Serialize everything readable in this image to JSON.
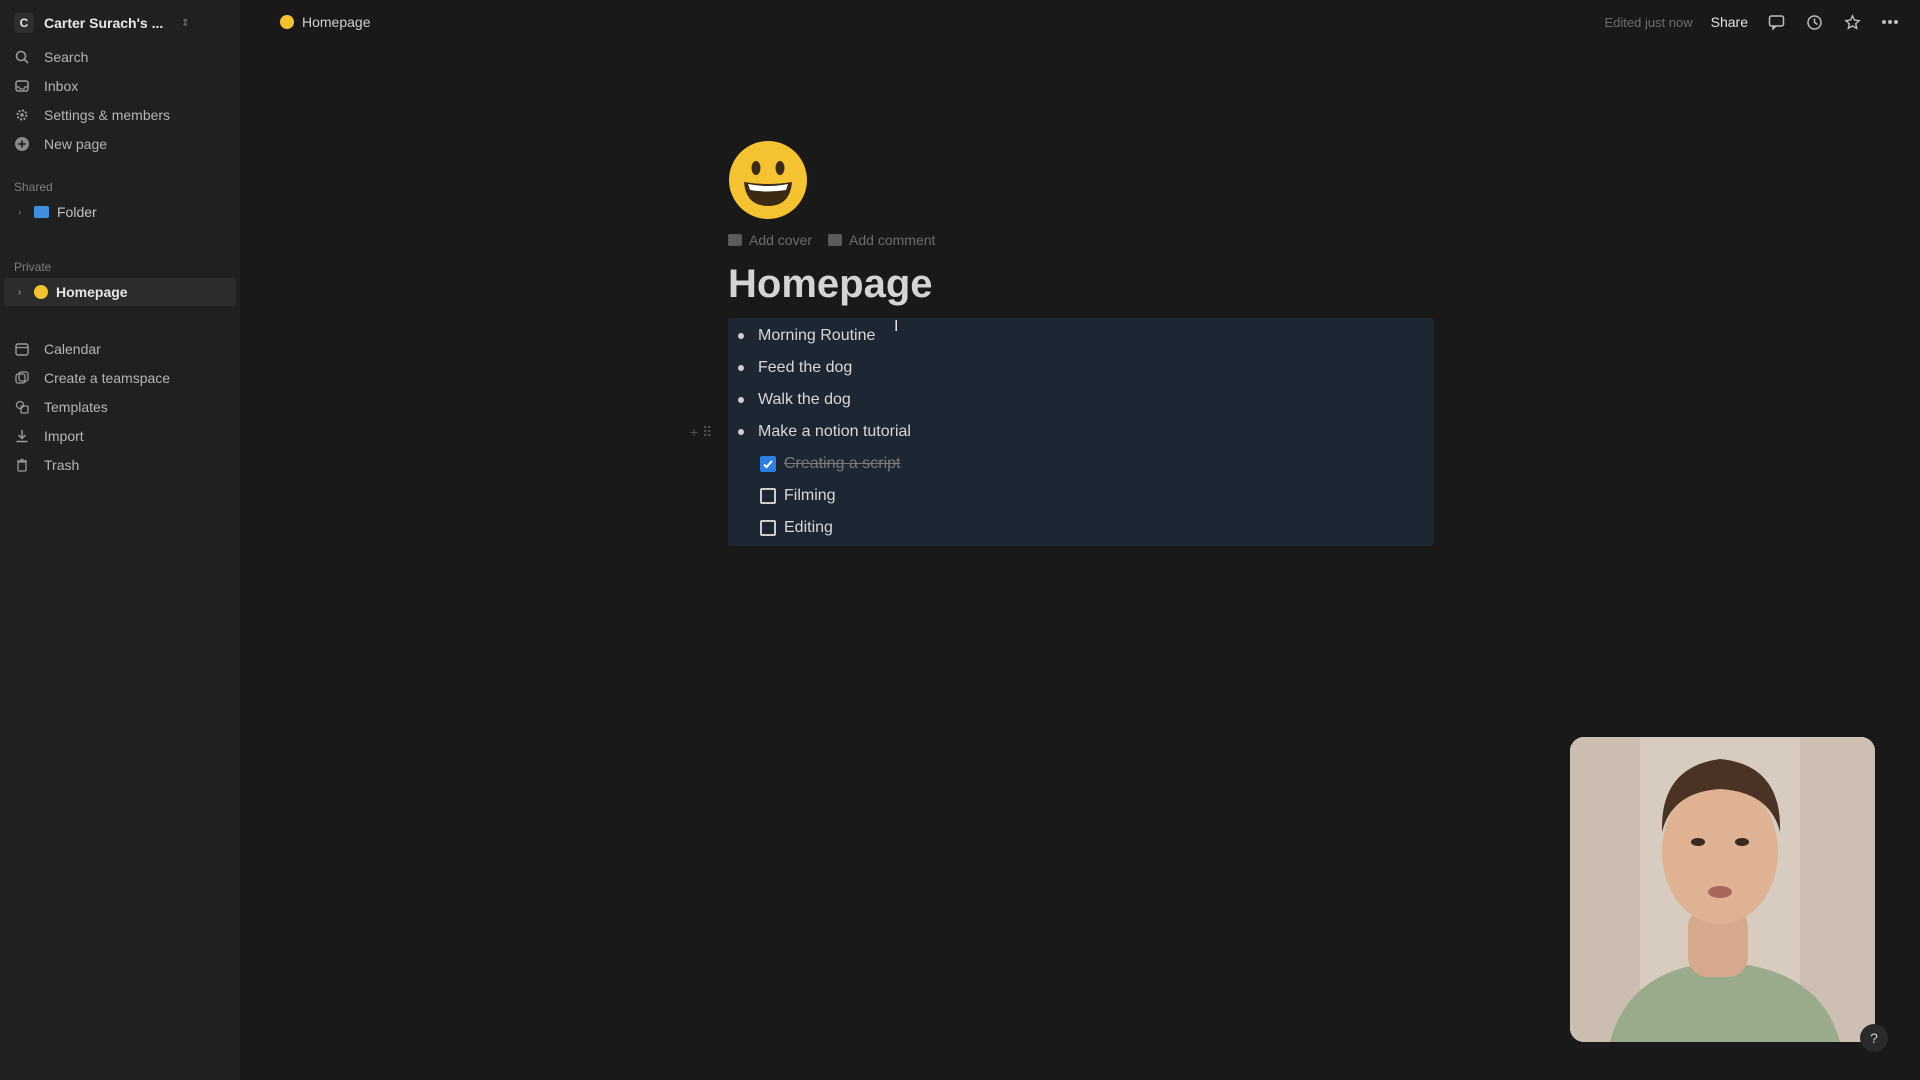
{
  "sidebar": {
    "workspace_initial": "C",
    "workspace_name": "Carter Surach's ...",
    "nav": [
      {
        "label": "Search",
        "icon": "search-icon"
      },
      {
        "label": "Inbox",
        "icon": "inbox-icon"
      },
      {
        "label": "Settings & members",
        "icon": "gear-icon"
      },
      {
        "label": "New page",
        "icon": "plus-circle-icon"
      }
    ],
    "shared_label": "Shared",
    "shared_items": [
      {
        "label": "Folder",
        "icon": "folder-icon"
      }
    ],
    "private_label": "Private",
    "private_items": [
      {
        "label": "Homepage",
        "icon": "smiley-emoji-icon"
      }
    ],
    "bottom": [
      {
        "label": "Calendar",
        "icon": "calendar-icon"
      },
      {
        "label": "Create a teamspace",
        "icon": "teamspace-icon"
      },
      {
        "label": "Templates",
        "icon": "templates-icon"
      },
      {
        "label": "Import",
        "icon": "import-icon"
      },
      {
        "label": "Trash",
        "icon": "trash-icon"
      }
    ]
  },
  "topbar": {
    "breadcrumb": "Homepage",
    "edited": "Edited just now",
    "share": "Share"
  },
  "page": {
    "emoji": "😀",
    "add_cover": "Add cover",
    "add_comment": "Add comment",
    "title": "Homepage",
    "bullets": [
      "Morning Routine",
      "Feed the dog",
      "Walk the dog",
      "Make a notion tutorial"
    ],
    "todos": [
      {
        "label": "Creating a script",
        "checked": true
      },
      {
        "label": "Filming",
        "checked": false
      },
      {
        "label": "Editing",
        "checked": false
      }
    ]
  },
  "help": "?",
  "colors": {
    "background": "#191919",
    "sidebar": "#202020",
    "selection": "#1d2734",
    "checkbox": "#2e7de1",
    "emoji_yellow": "#f2c230"
  }
}
